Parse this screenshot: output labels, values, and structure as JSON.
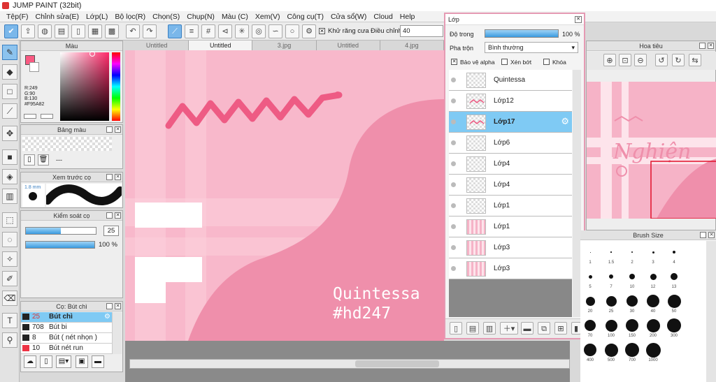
{
  "app": {
    "title": "JUMP PAINT (32bit)"
  },
  "menu": [
    "Tệp(F)",
    "Chỉnh sửa(E)",
    "Lớp(L)",
    "Bộ lọc(R)",
    "Chọn(S)",
    "Chụp(N)",
    "Màu (C)",
    "Xem(V)",
    "Công cụ(T)",
    "Cửa sổ(W)",
    "Cloud",
    "Help"
  ],
  "toolbar": {
    "antialias_label": "Khử răng cưa",
    "adjust_label": "Điều chỉnh",
    "adjust_value": "40"
  },
  "tabs": [
    "Untitled",
    "Untitled",
    "3.jpg",
    "Untitled",
    "4.jpg"
  ],
  "color_panel": {
    "title": "Màu",
    "r": "R:249",
    "g": "G:90",
    "b": "B:130",
    "hex": "#F95A82",
    "fg": "#F95A82"
  },
  "palette_panel": {
    "title": "Bảng màu",
    "label": "---"
  },
  "preview_panel": {
    "title": "Xem trước cọ",
    "size": "1.8 mm"
  },
  "brush_ctrl": {
    "title": "Kiểm soát cọ",
    "size": "25",
    "opacity": "100 %",
    "size_level": 0.5,
    "opacity_level": 1.0
  },
  "brush_list": {
    "title": "Cọ: Bút chì",
    "items": [
      {
        "size": "25",
        "name": "Bút chì",
        "color": "#222222"
      },
      {
        "size": "708",
        "name": "Bút bi",
        "color": "#222222"
      },
      {
        "size": "8",
        "name": "Bút ( nét nhọn )",
        "color": "#222222"
      },
      {
        "size": "10",
        "name": "Bút nét run",
        "color": "#ee3344"
      }
    ]
  },
  "artwork": {
    "text_line1": "Quintessa",
    "text_line2": "#hd247"
  },
  "layers": {
    "title": "Lớp",
    "opacity_label": "Độ trong",
    "opacity_value": "100 %",
    "blend_label": "Pha trộn",
    "blend_value": "Bình thường",
    "alpha_label": "Bảo vệ alpha",
    "clip_label": "Xén bớt",
    "lock_label": "Khóa",
    "items": [
      "Quintessa",
      "Lớp12",
      "Lớp17",
      "Lớp6",
      "Lớp4",
      "Lớp4",
      "Lớp1",
      "Lớp1",
      "Lớp3",
      "Lớp3"
    ],
    "selected": 2
  },
  "navigator": {
    "title": "Hoa tiêu",
    "preview_text": "Nghiện"
  },
  "brush_size": {
    "title": "Brush Size",
    "sizes": [
      "1",
      "1.5",
      "2",
      "3",
      "4",
      "5",
      "7",
      "10",
      "12",
      "13",
      "20",
      "25",
      "30",
      "40",
      "50",
      "70",
      "100",
      "150",
      "200",
      "300",
      "400",
      "500",
      "700",
      "1000"
    ]
  }
}
